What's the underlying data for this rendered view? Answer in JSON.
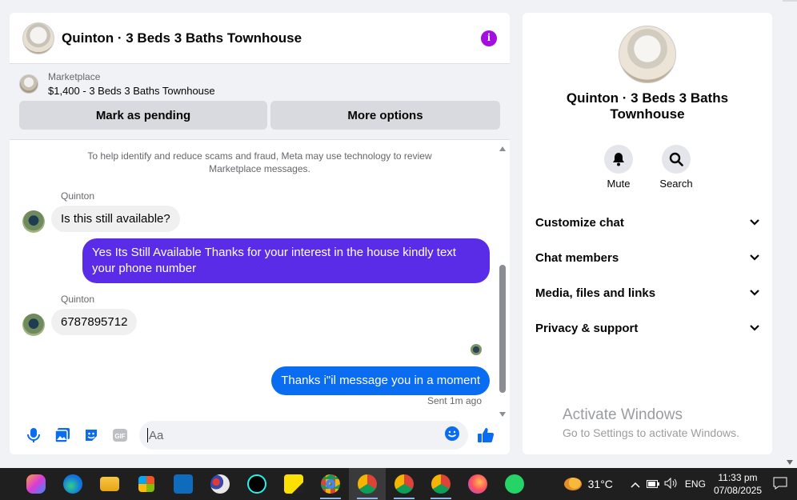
{
  "chat": {
    "title": "Quinton · 3 Beds 3 Baths Townhouse",
    "listing": {
      "label": "Marketplace",
      "name": "$1,400 - 3 Beds 3 Baths Townhouse",
      "mark_pending": "Mark as pending",
      "more_options": "More options"
    },
    "notice": "To help identify and reduce scams and fraud, Meta may use technology to review Marketplace messages.",
    "messages": [
      {
        "sender": "Quinton",
        "text": "Is this still available?",
        "direction": "in"
      },
      {
        "text": "Yes Its Still Available Thanks for your interest in the house kindly text your phone number",
        "direction": "out"
      },
      {
        "sender": "Quinton",
        "text": "6787895712",
        "direction": "in"
      },
      {
        "text": "Thanks i\"il message you in a moment",
        "direction": "out"
      }
    ],
    "sent_status": "Sent 1m ago",
    "composer_placeholder": "Aa",
    "colors": {
      "outgoing": "#5b2ce8",
      "outgoing_latest": "#0a6cf0",
      "accent": "#a30fe0"
    }
  },
  "info_panel": {
    "name": "Quinton · 3 Beds 3 Baths Townhouse",
    "actions": [
      {
        "label": "Mute",
        "icon": "bell-icon"
      },
      {
        "label": "Search",
        "icon": "search-icon"
      }
    ],
    "sections": [
      "Customize chat",
      "Chat members",
      "Media, files and links",
      "Privacy & support"
    ]
  },
  "watermark": {
    "title": "Activate Windows",
    "subtitle": "Go to Settings to activate Windows."
  },
  "taskbar": {
    "weather": "31°C",
    "language": "ENG",
    "time": "11:33 pm",
    "date": "07/08/2025"
  }
}
